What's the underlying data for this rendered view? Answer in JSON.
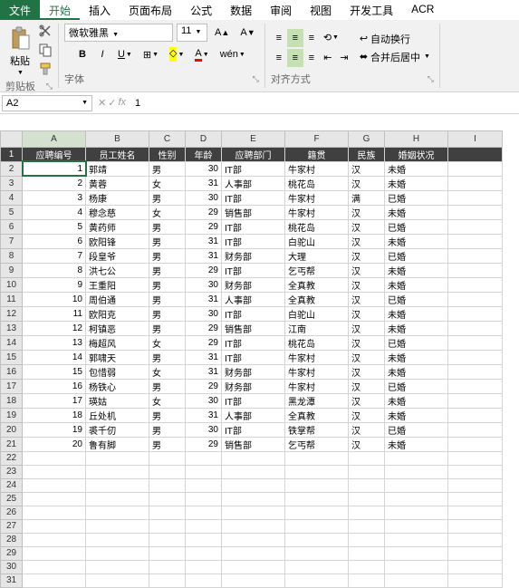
{
  "tabs": {
    "file": "文件",
    "home": "开始",
    "insert": "插入",
    "layout": "页面布局",
    "formula": "公式",
    "data": "数据",
    "review": "审阅",
    "view": "视图",
    "dev": "开发工具",
    "acro": "ACR"
  },
  "clipboard": {
    "paste": "粘贴",
    "group": "剪贴板"
  },
  "font": {
    "name": "微软雅黑",
    "size": "11",
    "group": "字体",
    "wen": "wén"
  },
  "align": {
    "wrap": "自动换行",
    "merge": "合并后居中",
    "group": "对齐方式"
  },
  "cell": {
    "ref": "A2",
    "value": "1"
  },
  "cols": [
    "A",
    "B",
    "C",
    "D",
    "E",
    "F",
    "G",
    "H",
    "I"
  ],
  "headers": [
    "应聘编号",
    "员工姓名",
    "性别",
    "年龄",
    "应聘部门",
    "籍贯",
    "民族",
    "婚姻状况"
  ],
  "rows": [
    [
      "1",
      "郭靖",
      "男",
      "30",
      "IT部",
      "牛家村",
      "汉",
      "未婚"
    ],
    [
      "2",
      "黄蓉",
      "女",
      "31",
      "人事部",
      "桃花岛",
      "汉",
      "未婚"
    ],
    [
      "3",
      "杨康",
      "男",
      "30",
      "IT部",
      "牛家村",
      "满",
      "已婚"
    ],
    [
      "4",
      "穆念慈",
      "女",
      "29",
      "销售部",
      "牛家村",
      "汉",
      "未婚"
    ],
    [
      "5",
      "黄药师",
      "男",
      "29",
      "IT部",
      "桃花岛",
      "汉",
      "已婚"
    ],
    [
      "6",
      "欧阳锋",
      "男",
      "31",
      "IT部",
      "白驼山",
      "汉",
      "未婚"
    ],
    [
      "7",
      "段皇爷",
      "男",
      "31",
      "财务部",
      "大理",
      "汉",
      "已婚"
    ],
    [
      "8",
      "洪七公",
      "男",
      "29",
      "IT部",
      "乞丐帮",
      "汉",
      "未婚"
    ],
    [
      "9",
      "王重阳",
      "男",
      "30",
      "财务部",
      "全真教",
      "汉",
      "未婚"
    ],
    [
      "10",
      "周伯通",
      "男",
      "31",
      "人事部",
      "全真教",
      "汉",
      "已婚"
    ],
    [
      "11",
      "欧阳克",
      "男",
      "30",
      "IT部",
      "白驼山",
      "汉",
      "未婚"
    ],
    [
      "12",
      "柯镇恶",
      "男",
      "29",
      "销售部",
      "江南",
      "汉",
      "未婚"
    ],
    [
      "13",
      "梅超风",
      "女",
      "29",
      "IT部",
      "桃花岛",
      "汉",
      "已婚"
    ],
    [
      "14",
      "郭啸天",
      "男",
      "31",
      "IT部",
      "牛家村",
      "汉",
      "未婚"
    ],
    [
      "15",
      "包惜弱",
      "女",
      "31",
      "财务部",
      "牛家村",
      "汉",
      "未婚"
    ],
    [
      "16",
      "杨铁心",
      "男",
      "29",
      "财务部",
      "牛家村",
      "汉",
      "已婚"
    ],
    [
      "17",
      "瑛姑",
      "女",
      "30",
      "IT部",
      "黑龙潭",
      "汉",
      "未婚"
    ],
    [
      "18",
      "丘处机",
      "男",
      "31",
      "人事部",
      "全真教",
      "汉",
      "未婚"
    ],
    [
      "19",
      "裘千仞",
      "男",
      "30",
      "IT部",
      "铁掌帮",
      "汉",
      "已婚"
    ],
    [
      "20",
      "鲁有脚",
      "男",
      "29",
      "销售部",
      "乞丐帮",
      "汉",
      "未婚"
    ]
  ],
  "emptyRows": 10
}
